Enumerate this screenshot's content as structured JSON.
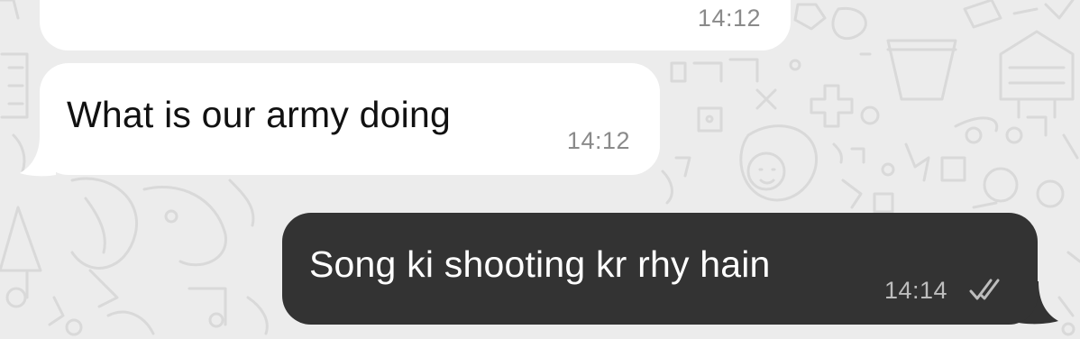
{
  "chat": {
    "messages": [
      {
        "direction": "incoming",
        "text": "",
        "time": "14:12"
      },
      {
        "direction": "incoming",
        "text": "What is our army doing",
        "time": "14:12"
      },
      {
        "direction": "outgoing",
        "text": "Song ki shooting kr rhy hain",
        "time": "14:14",
        "status_icon": "read-double-check-icon"
      }
    ]
  },
  "colors": {
    "wallpaper": "#ececec",
    "incoming_bubble": "#ffffff",
    "outgoing_bubble": "#333333",
    "incoming_text": "#111111",
    "outgoing_text": "#ffffff",
    "timestamp_incoming": "#8a8a8a",
    "timestamp_outgoing": "#bdbdbd"
  }
}
